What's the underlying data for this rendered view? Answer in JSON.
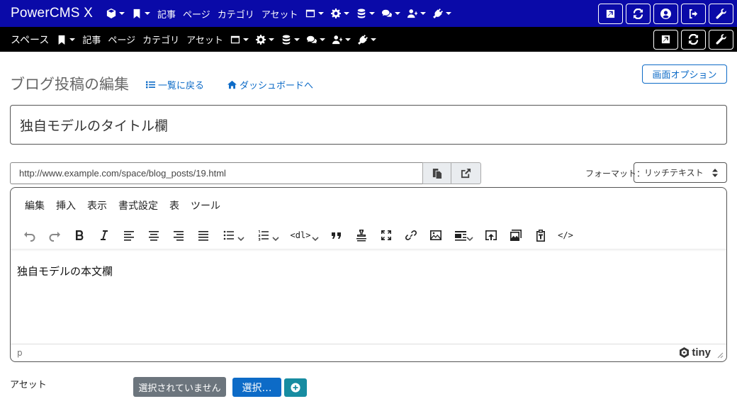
{
  "topbar": {
    "brand": "PowerCMS X",
    "items": [
      {
        "icon": "cube-icon",
        "label": "",
        "caret": true
      },
      {
        "icon": "bookmark-icon",
        "label": "",
        "caret": true
      },
      {
        "icon": "",
        "label": "記事",
        "caret": false
      },
      {
        "icon": "",
        "label": "ページ",
        "caret": false
      },
      {
        "icon": "",
        "label": "カテゴリ",
        "caret": false
      },
      {
        "icon": "",
        "label": "アセット",
        "caret": false
      },
      {
        "icon": "window-icon",
        "label": "",
        "caret": true
      },
      {
        "icon": "gear-icon",
        "label": "",
        "caret": true
      },
      {
        "icon": "database-icon",
        "label": "",
        "caret": true
      },
      {
        "icon": "comments-icon",
        "label": "",
        "caret": true
      },
      {
        "icon": "user-plus-icon",
        "label": "",
        "caret": true
      },
      {
        "icon": "plug-icon",
        "label": "",
        "caret": true
      }
    ],
    "right_buttons": [
      "external-link-icon",
      "refresh-icon",
      "user-circle-icon",
      "sign-out-icon",
      "wrench-icon"
    ]
  },
  "spacebar": {
    "space_label": "スペース",
    "items": [
      {
        "icon": "bookmark-icon",
        "label": "",
        "caret": true
      },
      {
        "icon": "",
        "label": "記事",
        "caret": false
      },
      {
        "icon": "",
        "label": "ページ",
        "caret": false
      },
      {
        "icon": "",
        "label": "カテゴリ",
        "caret": false
      },
      {
        "icon": "",
        "label": "アセット",
        "caret": false
      },
      {
        "icon": "window-icon",
        "label": "",
        "caret": true
      },
      {
        "icon": "gear-icon",
        "label": "",
        "caret": true
      },
      {
        "icon": "database-icon",
        "label": "",
        "caret": true
      },
      {
        "icon": "comments-icon",
        "label": "",
        "caret": true
      },
      {
        "icon": "user-plus-icon",
        "label": "",
        "caret": true
      },
      {
        "icon": "plug-icon",
        "label": "",
        "caret": true
      }
    ],
    "right_buttons": [
      "external-link-icon",
      "refresh-icon",
      "wrench-icon"
    ]
  },
  "header": {
    "title": "ブログ投稿の編集",
    "back_link": "一覧に戻る",
    "dashboard_link": "ダッシュボードへ",
    "screen_options": "画面オプション"
  },
  "form": {
    "title_value": "独自モデルのタイトル欄",
    "url_value": "http://www.example.com/space/blog_posts/19.html",
    "format_label": "フォーマット：",
    "format_value": "リッチテキスト"
  },
  "editor": {
    "menu": [
      "編集",
      "挿入",
      "表示",
      "書式設定",
      "表",
      "ツール"
    ],
    "toolbar": [
      "undo-icon",
      "redo-icon",
      "bold-icon",
      "italic-icon",
      "align-left-icon",
      "align-center-icon",
      "align-right-icon",
      "align-justify-icon",
      "bullet-list-icon",
      "numbered-list-icon",
      "definition-list-icon",
      "blockquote-icon",
      "stamp-icon",
      "fullscreen-icon",
      "link-icon",
      "image-icon",
      "media-icon",
      "embed-icon",
      "gallery-icon",
      "paste-text-icon",
      "code-icon"
    ],
    "dl_label": "<dl>",
    "code_label": "</>",
    "body_text": "独自モデルの本文欄",
    "path": "p",
    "brand": "tiny"
  },
  "assets": {
    "label": "アセット",
    "none_selected": "選択されていません",
    "select_button": "選択…"
  },
  "colors": {
    "topbar": "#0a0aa8",
    "spacebar": "#000000",
    "link": "#0d6bc7",
    "gray_button": "#6c757d",
    "teal_button": "#178ca1"
  }
}
